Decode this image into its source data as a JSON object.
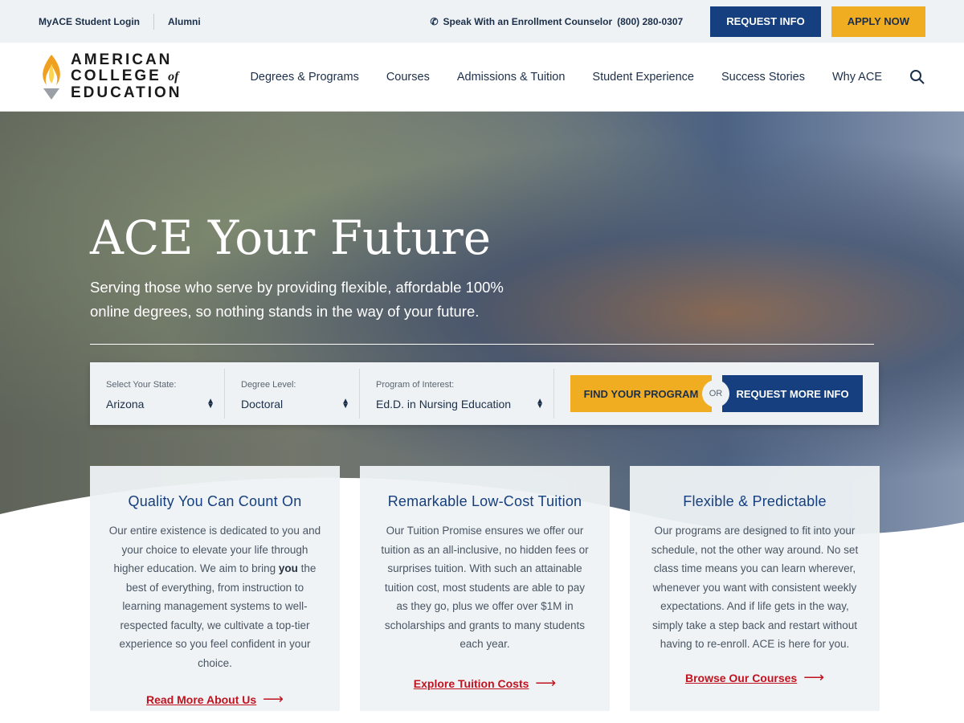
{
  "topbar": {
    "login": "MyACE Student Login",
    "alumni": "Alumni",
    "counselor": "Speak With an Enrollment Counselor",
    "phone": "(800) 280-0307",
    "request_info": "REQUEST INFO",
    "apply_now": "APPLY NOW"
  },
  "logo": {
    "line1": "AMERICAN",
    "line2": "COLLEGE",
    "of": "of",
    "line3": "EDUCATION"
  },
  "nav": [
    "Degrees & Programs",
    "Courses",
    "Admissions & Tuition",
    "Student Experience",
    "Success Stories",
    "Why ACE"
  ],
  "hero": {
    "title": "ACE Your Future",
    "subtitle": "Serving those who serve by providing flexible, affordable 100% online degrees, so nothing stands in the way of your future."
  },
  "finder": {
    "state_label": "Select Your State:",
    "state": "Arizona",
    "degree_label": "Degree Level:",
    "degree": "Doctoral",
    "program_label": "Program of Interest:",
    "program": "Ed.D. in Nursing Education",
    "find": "FIND YOUR PROGRAM",
    "or": "OR",
    "request": "REQUEST MORE INFO"
  },
  "cards": [
    {
      "title": "Quality You Can Count On",
      "body_before": "Our entire existence is dedicated to you and your choice to elevate your life through higher education. We aim to bring ",
      "body_bold": "you",
      "body_after": " the best of everything, from instruction to learning management systems to well-respected faculty, we cultivate a top-tier experience so you feel confident in your choice.",
      "link": "Read More About Us"
    },
    {
      "title": "Remarkable Low-Cost Tuition",
      "body": "Our Tuition Promise ensures we offer our tuition as an all-inclusive, no hidden fees or surprises tuition. With such an attainable tuition cost, most students are able to pay as they go, plus we offer over $1M in scholarships and grants to many students each year.",
      "link": "Explore Tuition Costs"
    },
    {
      "title": "Flexible & Predictable",
      "body": "Our programs are designed to fit into your schedule, not the other way around. No set class time means you can learn wherever, whenever you want with consistent weekly expectations. And if life gets in the way, simply take a step back and restart without having to re-enroll. ACE is here for you.",
      "link": "Browse Our Courses"
    }
  ],
  "colors": {
    "brand_blue": "#153f7e",
    "gold": "#f0ad22",
    "link_red": "#c1121f"
  }
}
